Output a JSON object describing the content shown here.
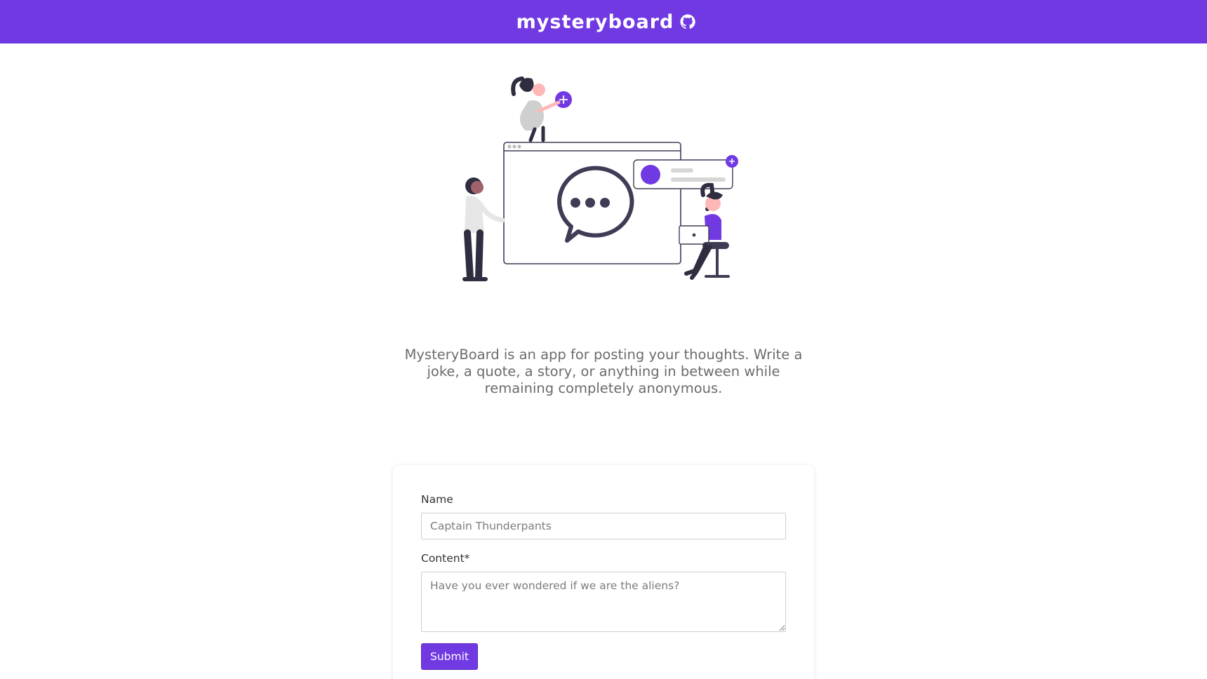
{
  "navbar": {
    "brand": "mysteryboard",
    "brand_icon": "github-icon",
    "background": "#7139e2"
  },
  "hero": {
    "illustration": "people-chatting-illustration",
    "description": "MysteryBoard is an app for posting your thoughts. Write a joke, a quote, a story, or anything in between while remaining completely anonymous."
  },
  "form": {
    "name_label": "Name",
    "name_placeholder": "Captain Thunderpants",
    "content_label": "Content*",
    "content_placeholder": "Have you ever wondered if we are the aliens?",
    "submit_label": "Submit"
  },
  "colors": {
    "accent": "#7139e2",
    "text_muted": "#6b6b6b"
  }
}
